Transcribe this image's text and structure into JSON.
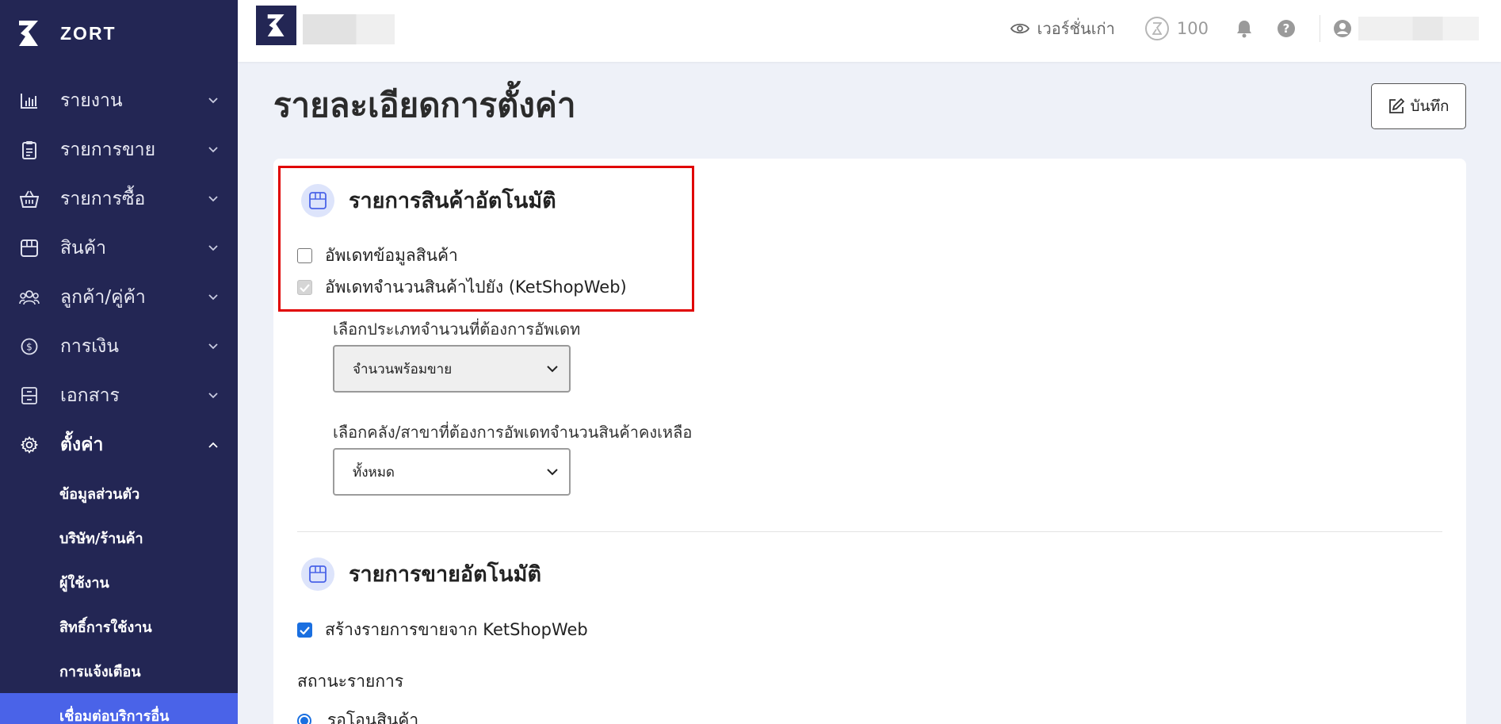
{
  "brand": {
    "name": "ZORT"
  },
  "sidebar": {
    "items": [
      {
        "label": "รายงาน",
        "icon": "chart-bar-icon"
      },
      {
        "label": "รายการขาย",
        "icon": "clipboard-icon"
      },
      {
        "label": "รายการซื้อ",
        "icon": "basket-icon"
      },
      {
        "label": "สินค้า",
        "icon": "box-icon"
      },
      {
        "label": "ลูกค้า/คู่ค้า",
        "icon": "users-icon"
      },
      {
        "label": "การเงิน",
        "icon": "dollar-icon"
      },
      {
        "label": "เอกสาร",
        "icon": "archive-icon"
      },
      {
        "label": "ตั้งค่า",
        "icon": "gear-icon"
      }
    ],
    "settings_sub": [
      "ข้อมูลส่วนตัว",
      "บริษัท/ร้านค้า",
      "ผู้ใช้งาน",
      "สิทธิ์การใช้งาน",
      "การแจ้งเตือน",
      "เชื่อมต่อบริการอื่น"
    ]
  },
  "topbar": {
    "old_version": "เวอร์ชั่นเก่า",
    "coins": "100"
  },
  "page": {
    "title": "รายละเอียดการตั้งค่า",
    "save_label": "บันทึก"
  },
  "auto_product": {
    "title": "รายการสินค้าอัตโนมัติ",
    "opt_update_info": "อัพเดทข้อมูลสินค้า",
    "opt_update_qty": "อัพเดทจำนวนสินค้าไปยัง (KetShopWeb)",
    "qty_type_label": "เลือกประเภทจำนวนที่ต้องการอัพเดท",
    "qty_type_value": "จำนวนพร้อมขาย",
    "warehouse_label": "เลือกคลัง/สาขาที่ต้องการอัพเดทจำนวนสินค้าคงเหลือ",
    "warehouse_value": "ทั้งหมด"
  },
  "auto_sale": {
    "title": "รายการขายอัตโนมัติ",
    "opt_create_sale": "สร้างรายการขายจาก KetShopWeb",
    "status_label": "สถานะรายการ",
    "status_option": "รอโอนสินค้า"
  },
  "colors": {
    "sidebar_bg": "#232654",
    "accent": "#4a63e8",
    "highlight_frame": "#e00000"
  }
}
